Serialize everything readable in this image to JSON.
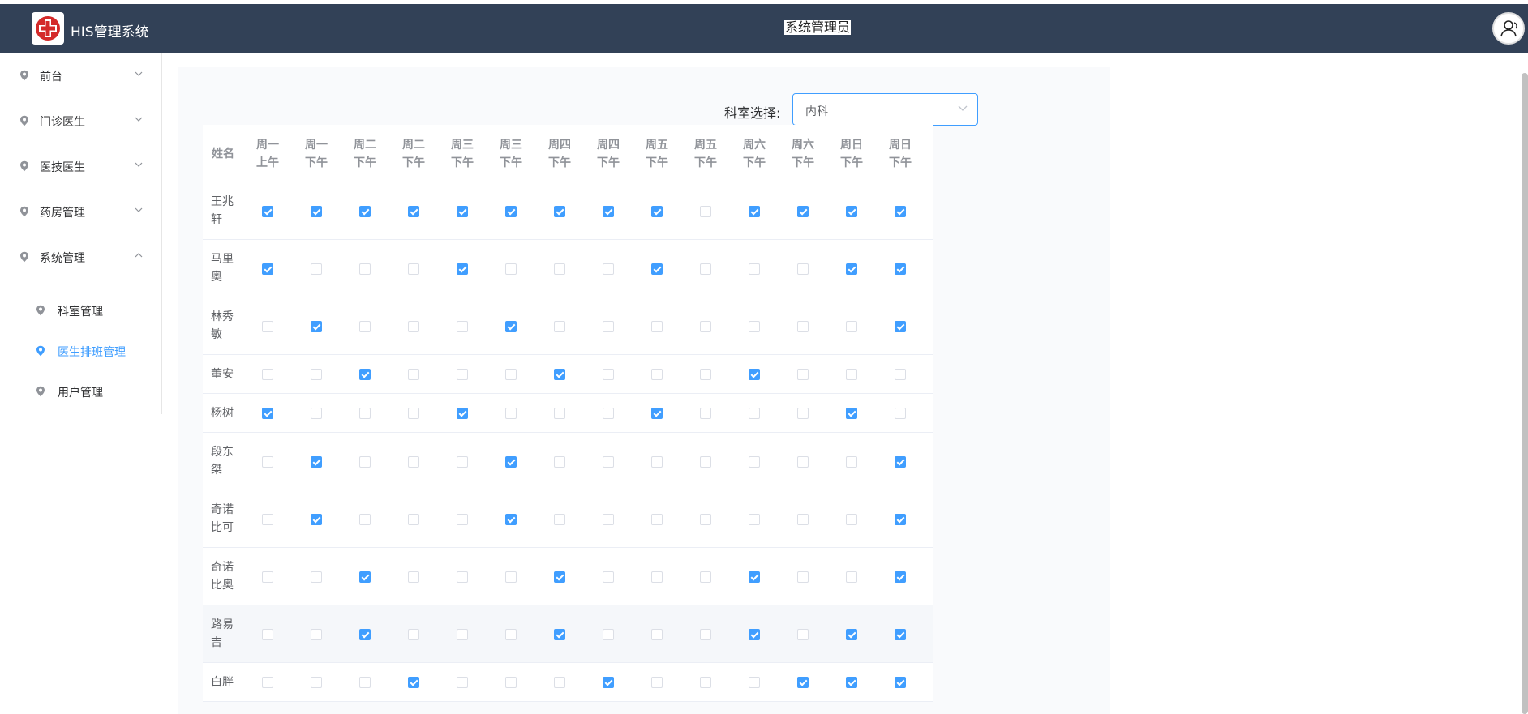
{
  "header": {
    "app_title": "HIS管理系统",
    "role": "系统管理员"
  },
  "sidebar": {
    "items": [
      {
        "label": "前台",
        "expanded": false
      },
      {
        "label": "门诊医生",
        "expanded": false
      },
      {
        "label": "医技医生",
        "expanded": false
      },
      {
        "label": "药房管理",
        "expanded": false
      },
      {
        "label": "系统管理",
        "expanded": true
      }
    ],
    "sub_items": [
      {
        "label": "科室管理",
        "active": false
      },
      {
        "label": "医生排班管理",
        "active": true
      },
      {
        "label": "用户管理",
        "active": false
      }
    ]
  },
  "filter": {
    "label": "科室选择:",
    "value": "内科"
  },
  "table": {
    "name_header": "姓名",
    "columns": [
      {
        "day": "周一",
        "period": "上午"
      },
      {
        "day": "周一",
        "period": "下午"
      },
      {
        "day": "周二",
        "period": "下午"
      },
      {
        "day": "周二",
        "period": "下午"
      },
      {
        "day": "周三",
        "period": "下午"
      },
      {
        "day": "周三",
        "period": "下午"
      },
      {
        "day": "周四",
        "period": "下午"
      },
      {
        "day": "周四",
        "period": "下午"
      },
      {
        "day": "周五",
        "period": "下午"
      },
      {
        "day": "周五",
        "period": "下午"
      },
      {
        "day": "周六",
        "period": "下午"
      },
      {
        "day": "周六",
        "period": "下午"
      },
      {
        "day": "周日",
        "period": "下午"
      },
      {
        "day": "周日",
        "period": "下午"
      }
    ],
    "rows": [
      {
        "name": "王兆轩",
        "checks": [
          1,
          1,
          1,
          1,
          1,
          1,
          1,
          1,
          1,
          0,
          1,
          1,
          1,
          1
        ]
      },
      {
        "name": "马里奥",
        "checks": [
          1,
          0,
          0,
          0,
          1,
          0,
          0,
          0,
          1,
          0,
          0,
          0,
          1,
          1
        ]
      },
      {
        "name": "林秀敏",
        "checks": [
          0,
          1,
          0,
          0,
          0,
          1,
          0,
          0,
          0,
          0,
          0,
          0,
          0,
          1
        ]
      },
      {
        "name": "董安",
        "checks": [
          0,
          0,
          1,
          0,
          0,
          0,
          1,
          0,
          0,
          0,
          1,
          0,
          0,
          0
        ]
      },
      {
        "name": "杨树",
        "checks": [
          1,
          0,
          0,
          0,
          1,
          0,
          0,
          0,
          1,
          0,
          0,
          0,
          1,
          0
        ]
      },
      {
        "name": "段东桀",
        "checks": [
          0,
          1,
          0,
          0,
          0,
          1,
          0,
          0,
          0,
          0,
          0,
          0,
          0,
          1
        ]
      },
      {
        "name": "奇诺比可",
        "checks": [
          0,
          1,
          0,
          0,
          0,
          1,
          0,
          0,
          0,
          0,
          0,
          0,
          0,
          1
        ]
      },
      {
        "name": "奇诺比奥",
        "checks": [
          0,
          0,
          1,
          0,
          0,
          0,
          1,
          0,
          0,
          0,
          1,
          0,
          0,
          1
        ]
      },
      {
        "name": "路易吉",
        "checks": [
          0,
          0,
          1,
          0,
          0,
          0,
          1,
          0,
          0,
          0,
          1,
          0,
          1,
          1
        ],
        "highlighted": true
      },
      {
        "name": "白胖",
        "checks": [
          0,
          0,
          0,
          1,
          0,
          0,
          0,
          1,
          0,
          0,
          0,
          1,
          1,
          1
        ]
      }
    ]
  },
  "colors": {
    "header_bg": "#324157",
    "accent": "#409eff"
  }
}
